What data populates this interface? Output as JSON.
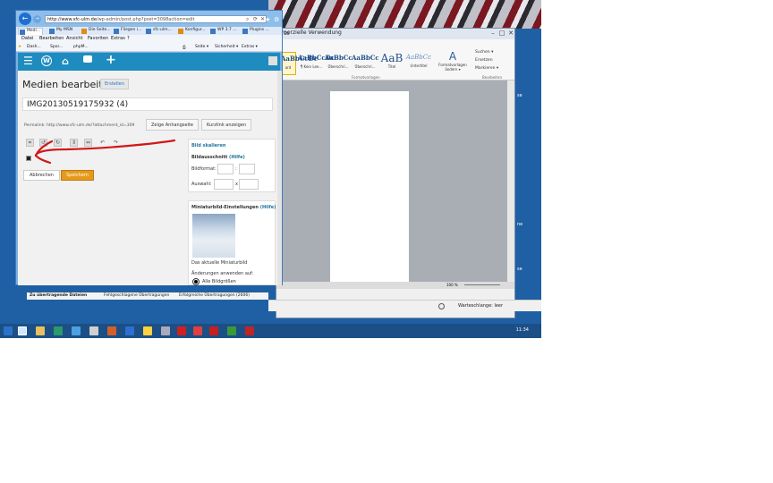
{
  "word": {
    "title_fragment": "ss",
    "title_text": "merzielle Verwendung",
    "styles": [
      {
        "sample": "AaBbCcDc",
        "name": "ard"
      },
      {
        "sample": "AaBbCcDc",
        "name": "¶ Kein Lee..."
      },
      {
        "sample": "AaBbCc",
        "name": "Überschri..."
      },
      {
        "sample": "AaBbCc",
        "name": "Überschri..."
      },
      {
        "sample": "AaB",
        "name": "Titel"
      },
      {
        "sample": "AaBbCc",
        "name": "Untertitel"
      }
    ],
    "format_button": "Formatvorlagen ändern ▾",
    "group_styles": "Formatvorlagen",
    "group_edit": "Bearbeiten",
    "edit_items": [
      "Suchen ▾",
      "Ersetzen",
      "Markieren ▾"
    ],
    "zoom": "100 %",
    "side_marks": [
      "se",
      "ne",
      "se"
    ]
  },
  "transfers": {
    "labels": [
      "Zu übertragende Dateien",
      "Fehlgeschlagene Übertragungen",
      "Erfolgreiche Übertragungen (2606)"
    ],
    "queue": "Warteschlange: leer"
  },
  "taskbar": {
    "clock": "11:34"
  },
  "ie": {
    "url_host": "http://www.sfc-ulm.de",
    "url_path": "/wp-admin/post.php?post=3098action=edit",
    "tabs": [
      "Medi...",
      "My MSN",
      "Die Seite...",
      "Fliegen i...",
      "sfc-ulm...",
      "Konfigur...",
      "WP 3.7 ...",
      "Plugins ..."
    ],
    "menu": [
      "Datei",
      "Bearbeiten",
      "Ansicht",
      "Favoriten",
      "Extras",
      "?"
    ],
    "favorites": [
      "Dash...",
      "Spor...",
      "phpM..."
    ],
    "commands": [
      "Seite ▾",
      "Sicherheit ▾",
      "Extras ▾"
    ]
  },
  "wp": {
    "page_title": "Medien bearbeiten",
    "add_new": "Erstellen",
    "file_name": "IMG20130519175932 (4)",
    "permalink": "Permalink: http://www.sfc-ulm.de/?attachment_id=309",
    "view_button": "Zeige Anhangseite",
    "shortlink_button": "Kurzlink anzeigen",
    "cancel": "Abbrechen",
    "save": "Speichern",
    "scale_title": "Bild skalieren",
    "crop_title": "Bildausschnitt",
    "help": "(Hilfe)",
    "aspect_label": "Bildformat:",
    "selection_label": "Auswahl:",
    "sep": ":",
    "sep_x": "x",
    "thumb_title": "Miniaturbild-Einstellungen",
    "thumb_caption": "Das aktuelle Miniaturbild",
    "apply_label": "Änderungen anwenden auf:",
    "options": [
      "Alle Bildgrößen",
      "Miniaturbild"
    ]
  }
}
